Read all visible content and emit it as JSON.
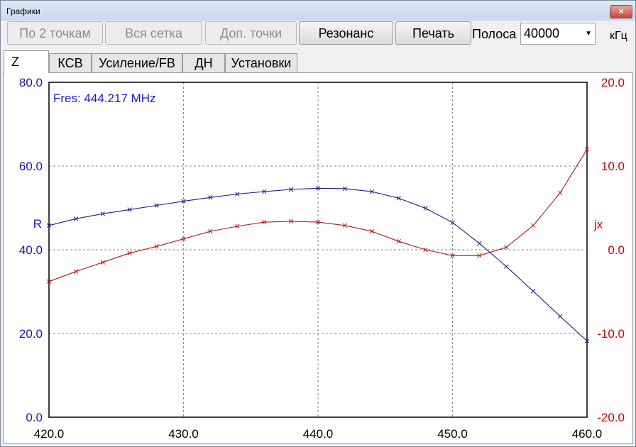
{
  "window": {
    "title": "Графики",
    "close_glyph": "×"
  },
  "toolbar": {
    "btn_two_points": "По 2 точкам",
    "btn_full_grid": "Вся сетка",
    "btn_extra_points": "Доп. точки",
    "btn_resonance": "Резонанс",
    "btn_print": "Печать",
    "band_label": "Полоса",
    "band_value": "40000",
    "band_unit": "кГц"
  },
  "tabs": [
    {
      "label": "Z",
      "active": true
    },
    {
      "label": "КСВ",
      "active": false
    },
    {
      "label": "Усиление/FB",
      "active": false
    },
    {
      "label": "ДН",
      "active": false
    },
    {
      "label": "Установки",
      "active": false
    }
  ],
  "chart_data": {
    "type": "line",
    "annotation": "Fres: 444.217 MHz",
    "ylabel_left": "R",
    "ylabel_right": "jx",
    "xlim": [
      420,
      460
    ],
    "ylim_left": [
      0,
      80
    ],
    "ylim_right": [
      -20,
      20
    ],
    "x_ticks": [
      "420.0",
      "430.0",
      "440.0",
      "450.0",
      "460.0"
    ],
    "y_left_ticks": [
      "0.0",
      "20.0",
      "40.0",
      "60.0",
      "80.0"
    ],
    "y_right_ticks": [
      "-20.0",
      "-10.0",
      "0.0",
      "10.0",
      "20.0"
    ],
    "grid": true,
    "colors": {
      "R": "#1a1a8c",
      "jx": "#b01818",
      "axis_left": "#1818b0",
      "axis_right": "#cc0000",
      "annotation": "#1a1acc"
    },
    "series": [
      {
        "name": "R",
        "axis": "left",
        "x": [
          420,
          422,
          424,
          426,
          428,
          430,
          432,
          434,
          436,
          438,
          440,
          442,
          444,
          446,
          448,
          450,
          452,
          454,
          456,
          458,
          460
        ],
        "y": [
          45.8,
          47.4,
          48.6,
          49.6,
          50.6,
          51.6,
          52.5,
          53.3,
          53.9,
          54.4,
          54.7,
          54.6,
          53.9,
          52.3,
          49.9,
          46.5,
          41.5,
          36.0,
          30.1,
          24.1,
          18.2
        ]
      },
      {
        "name": "jx",
        "axis": "right",
        "x": [
          420,
          422,
          424,
          426,
          428,
          430,
          432,
          434,
          436,
          438,
          440,
          442,
          444,
          446,
          448,
          450,
          452,
          454,
          456,
          458,
          460
        ],
        "y": [
          -3.8,
          -2.6,
          -1.5,
          -0.4,
          0.4,
          1.3,
          2.2,
          2.8,
          3.3,
          3.4,
          3.3,
          2.9,
          2.2,
          1.0,
          0.0,
          -0.7,
          -0.7,
          0.3,
          2.9,
          6.8,
          12.0
        ]
      }
    ]
  }
}
